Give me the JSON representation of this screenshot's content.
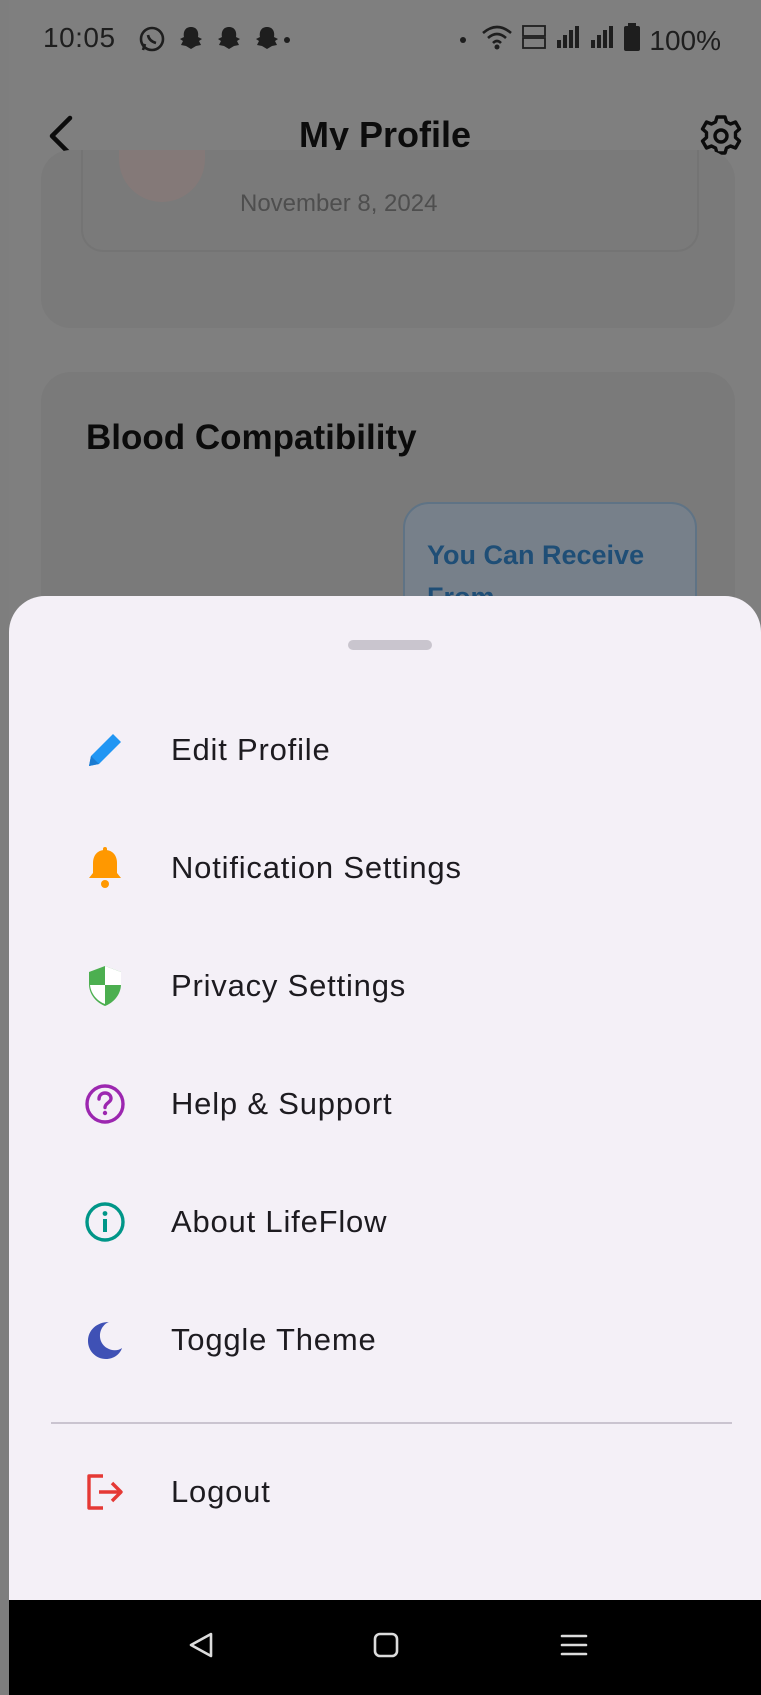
{
  "status_bar": {
    "time": "10:05",
    "battery": "100%",
    "left_icons": [
      "whatsapp-icon",
      "snapchat-icon",
      "snapchat-icon",
      "snapchat-icon"
    ],
    "right_icons": [
      "wifi-icon",
      "volte-icon",
      "signal-icon",
      "signal-icon",
      "battery-icon"
    ]
  },
  "app_bar": {
    "title": "My Profile",
    "back_icon": "chevron-left-icon",
    "settings_icon": "gear-icon"
  },
  "background": {
    "member_since_date": "November 8, 2024",
    "compat_title": "Blood Compatibility",
    "receive_label": "You Can Receive From"
  },
  "sheet": {
    "items": [
      {
        "label": "Edit Profile",
        "icon": "pencil-icon",
        "color": "#2196f3"
      },
      {
        "label": "Notification Settings",
        "icon": "bell-icon",
        "color": "#ff9800"
      },
      {
        "label": "Privacy Settings",
        "icon": "shield-icon",
        "color": "#4caf50"
      },
      {
        "label": "Help & Support",
        "icon": "help-circle-icon",
        "color": "#9c27b0"
      },
      {
        "label": "About LifeFlow",
        "icon": "info-circle-icon",
        "color": "#009688"
      },
      {
        "label": "Toggle Theme",
        "icon": "moon-icon",
        "color": "#3f51b5"
      }
    ],
    "logout": {
      "label": "Logout",
      "icon": "logout-icon",
      "color": "#e53935"
    }
  },
  "nav_bar": {
    "icons": [
      "back-triangle-icon",
      "home-square-icon",
      "recents-menu-icon"
    ]
  },
  "colors": {
    "sheet_background": "#f4f0f7",
    "scrim": "#7f7f7f"
  }
}
